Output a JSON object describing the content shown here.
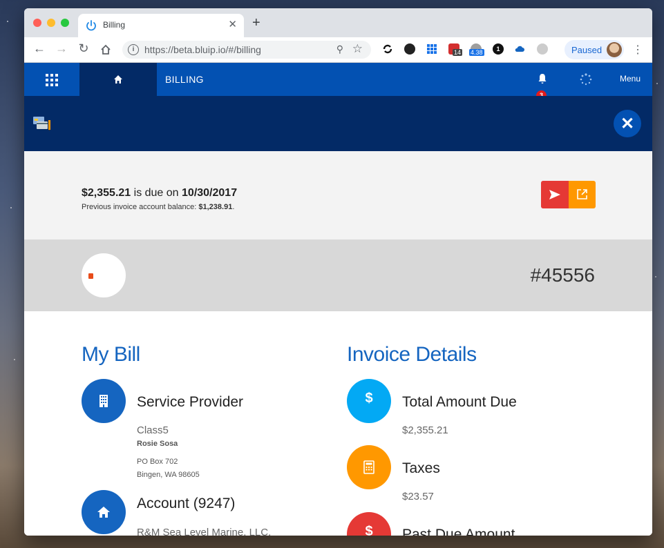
{
  "browser": {
    "tab_title": "Billing",
    "url": "https://beta.bluip.io/#/billing",
    "profile_status": "Paused",
    "ext_badge_1": "14",
    "ext_badge_2": "4.38",
    "ext_badge_3": "1"
  },
  "app": {
    "page_label": "BILLING",
    "notification_count": "3",
    "menu_label": "Menu"
  },
  "due": {
    "amount": "$2,355.21",
    "due_text": " is due on ",
    "due_date": "10/30/2017",
    "prev_label": "Previous invoice account balance: ",
    "prev_amount": "$1,238.91",
    "prev_suffix": "."
  },
  "invoice": {
    "number": "#45556"
  },
  "my_bill": {
    "title": "My Bill",
    "service_provider": {
      "title": "Service Provider",
      "name": "Class5",
      "contact": "Rosie Sosa",
      "address1": "PO Box 702",
      "address2": "Bingen, WA 98605"
    },
    "account": {
      "title": "Account (9247)",
      "name": "R&M Sea Level Marine, LLC."
    }
  },
  "invoice_details": {
    "title": "Invoice Details",
    "items": [
      {
        "label": "Total Amount Due",
        "value": "$2,355.21",
        "icon": "dollar-icon",
        "color": "#03a9f4"
      },
      {
        "label": "Taxes",
        "value": "$23.57",
        "icon": "calculator-icon",
        "color": "#ff9800"
      },
      {
        "label": "Past Due Amount",
        "value": "",
        "icon": "dollar-icon",
        "color": "#e53935"
      }
    ]
  },
  "colors": {
    "appbar": "#0351b2",
    "dark_band": "#032a66",
    "title_blue": "#1565c0",
    "provider_circle": "#1565c0"
  }
}
